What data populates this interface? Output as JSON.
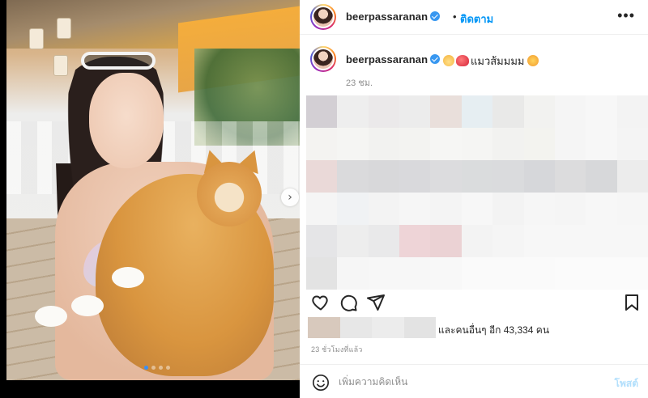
{
  "post": {
    "username": "beerpassaranan",
    "separator": "•",
    "follow_label": "ติดตาม",
    "more_icon": "•••",
    "caption_user": "beerpassaranan",
    "caption_text": "แมวส้มมมม",
    "caption_time": "23 ชม.",
    "next_icon": "›",
    "carousel_dot_count": 4,
    "carousel_active_dot": 1
  },
  "engagement": {
    "likes_text": "และคนอื่นๆ อีก 43,334 คน",
    "posted_ago": "23 ชั่วโมงที่แล้ว"
  },
  "comment": {
    "placeholder": "เพิ่มความคิดเห็น",
    "post_label": "โพสต์"
  },
  "colors": {
    "accent": "#0095f6",
    "verified": "#3897f0",
    "post_disabled": "#b2dffc",
    "muted": "#8e8e8e"
  }
}
